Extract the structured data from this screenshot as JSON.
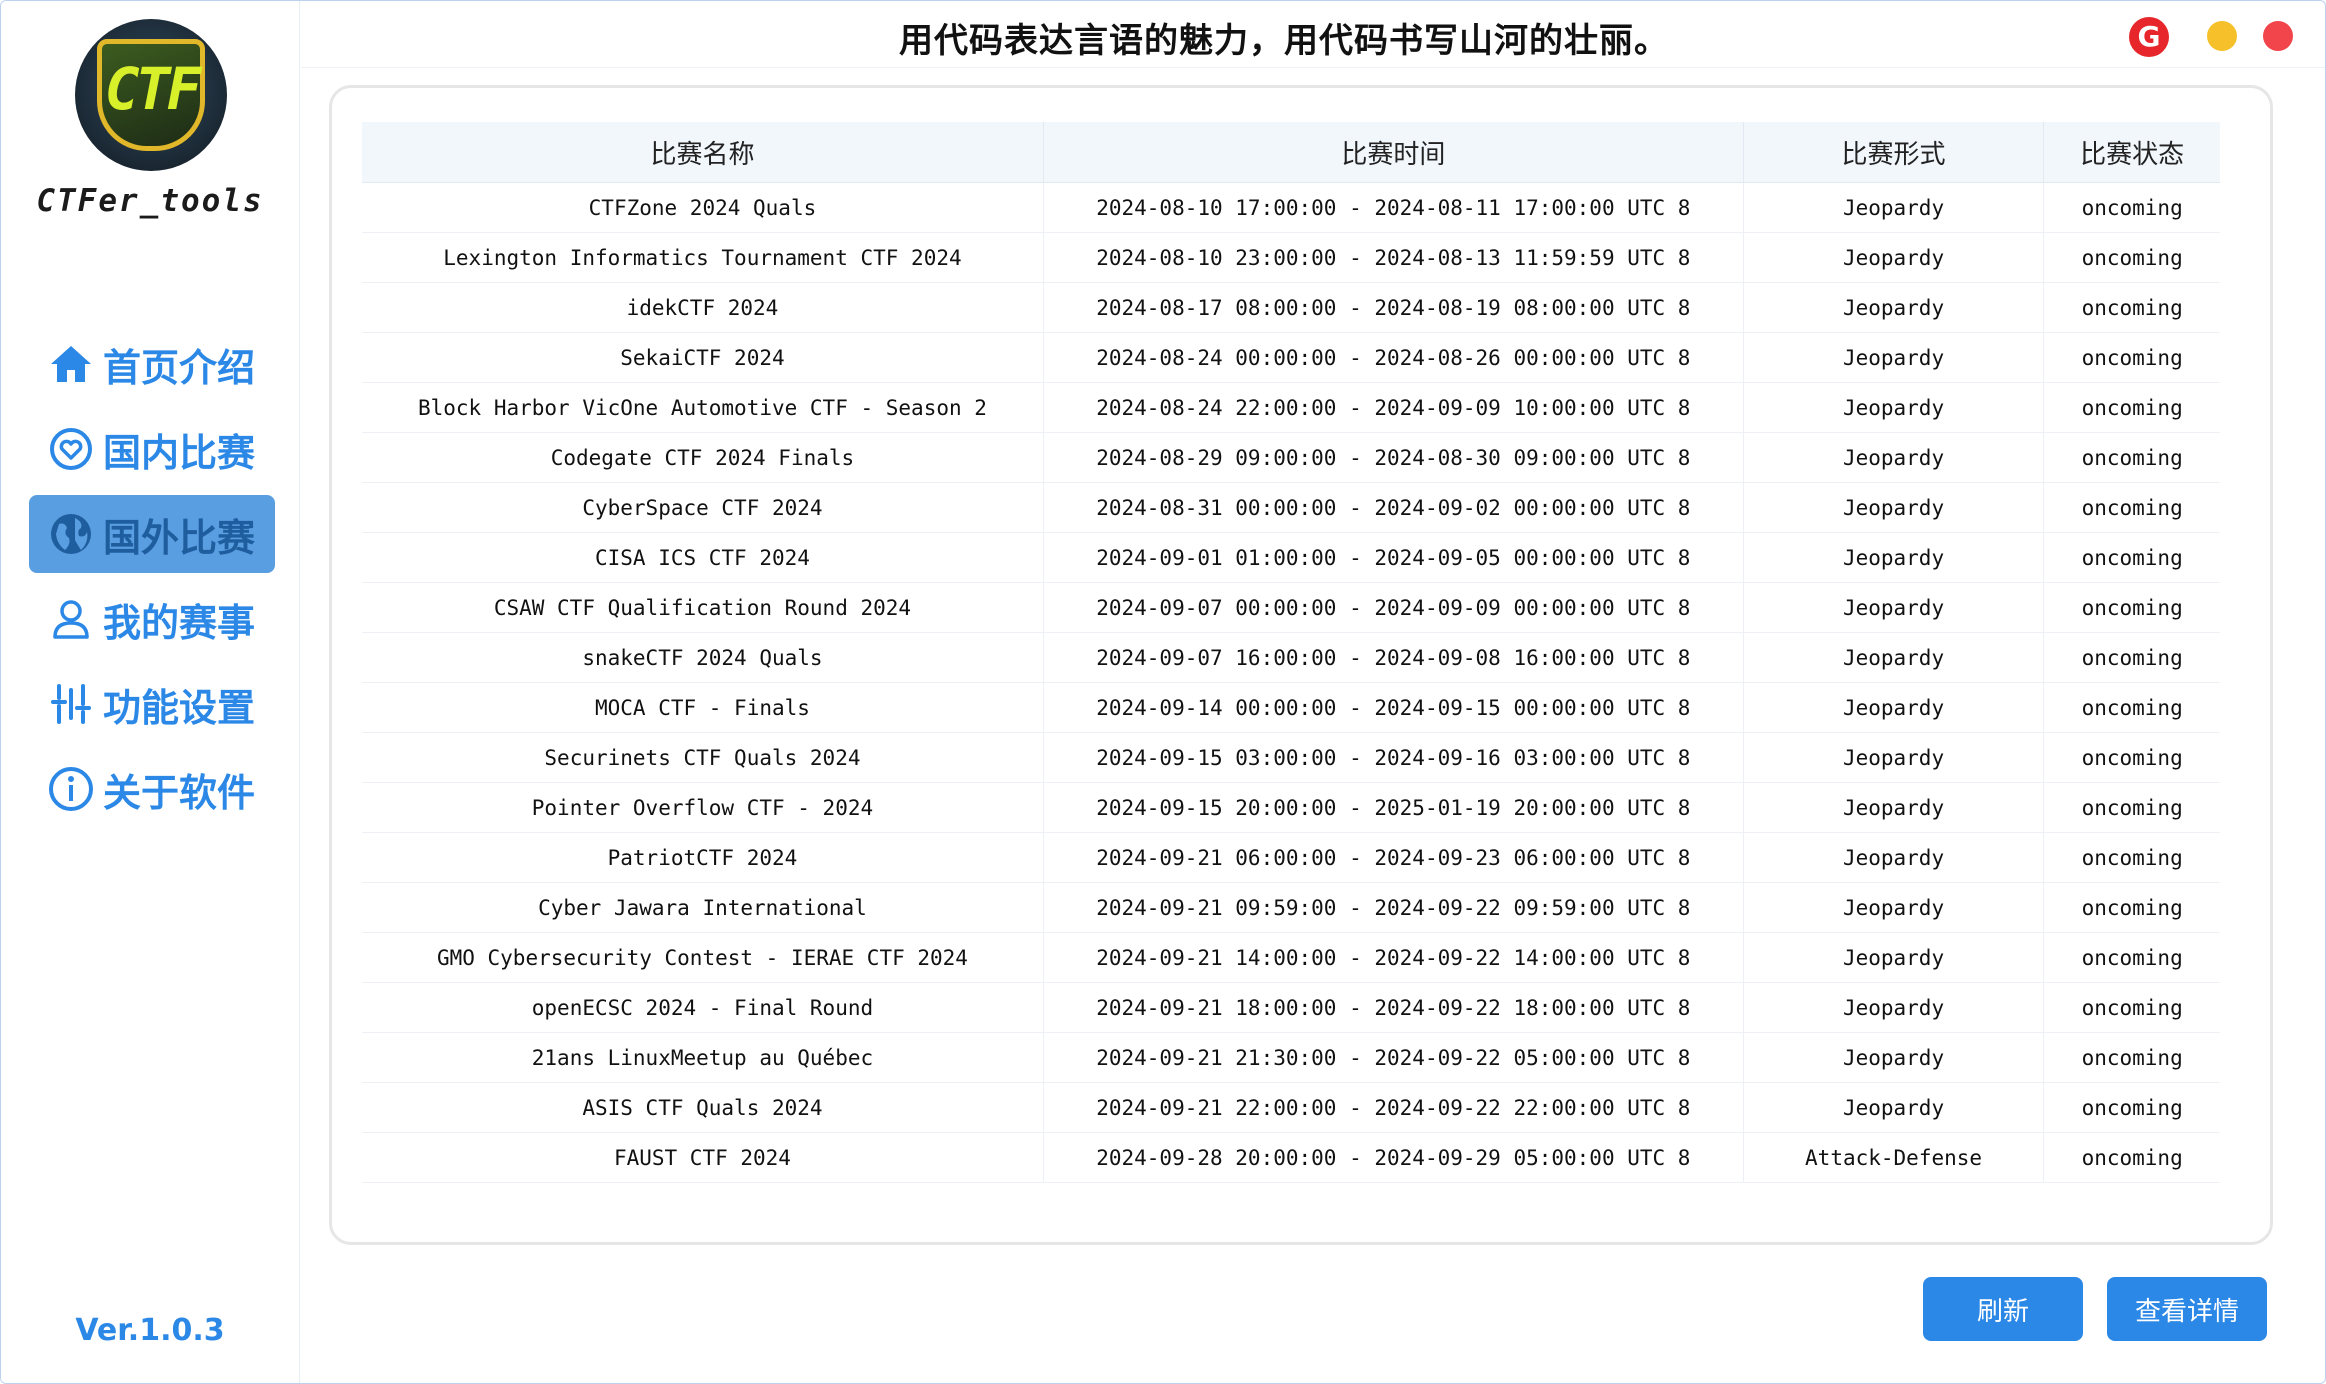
{
  "app": {
    "name": "CTFer_tools",
    "logo_text": "CTF",
    "version": "Ver.1.0.3",
    "slogan": "用代码表达言语的魅力，用代码书写山河的壮丽。"
  },
  "window_buttons": {
    "g_label": "G"
  },
  "sidebar": {
    "items": [
      {
        "label": "首页介绍",
        "icon": "home-icon"
      },
      {
        "label": "国内比赛",
        "icon": "heart-circle-icon"
      },
      {
        "label": "国外比赛",
        "icon": "globe-icon",
        "active": true
      },
      {
        "label": "我的赛事",
        "icon": "user-icon"
      },
      {
        "label": "功能设置",
        "icon": "sliders-icon"
      },
      {
        "label": "关于软件",
        "icon": "info-icon"
      }
    ]
  },
  "table": {
    "headers": [
      "比赛名称",
      "比赛时间",
      "比赛形式",
      "比赛状态"
    ],
    "rows": [
      [
        "CTFZone 2024 Quals",
        "2024-08-10 17:00:00 - 2024-08-11 17:00:00 UTC 8",
        "Jeopardy",
        "oncoming"
      ],
      [
        "Lexington Informatics Tournament CTF 2024",
        "2024-08-10 23:00:00 - 2024-08-13 11:59:59 UTC 8",
        "Jeopardy",
        "oncoming"
      ],
      [
        "idekCTF 2024",
        "2024-08-17 08:00:00 - 2024-08-19 08:00:00 UTC 8",
        "Jeopardy",
        "oncoming"
      ],
      [
        "SekaiCTF 2024",
        "2024-08-24 00:00:00 - 2024-08-26 00:00:00 UTC 8",
        "Jeopardy",
        "oncoming"
      ],
      [
        "Block Harbor VicOne Automotive CTF - Season 2",
        "2024-08-24 22:00:00 - 2024-09-09 10:00:00 UTC 8",
        "Jeopardy",
        "oncoming"
      ],
      [
        "Codegate CTF 2024 Finals",
        "2024-08-29 09:00:00 - 2024-08-30 09:00:00 UTC 8",
        "Jeopardy",
        "oncoming"
      ],
      [
        "CyberSpace CTF 2024",
        "2024-08-31 00:00:00 - 2024-09-02 00:00:00 UTC 8",
        "Jeopardy",
        "oncoming"
      ],
      [
        "CISA ICS CTF 2024",
        "2024-09-01 01:00:00 - 2024-09-05 00:00:00 UTC 8",
        "Jeopardy",
        "oncoming"
      ],
      [
        "CSAW CTF Qualification Round 2024",
        "2024-09-07 00:00:00 - 2024-09-09 00:00:00 UTC 8",
        "Jeopardy",
        "oncoming"
      ],
      [
        "snakeCTF 2024 Quals",
        "2024-09-07 16:00:00 - 2024-09-08 16:00:00 UTC 8",
        "Jeopardy",
        "oncoming"
      ],
      [
        "MOCA CTF - Finals",
        "2024-09-14 00:00:00 - 2024-09-15 00:00:00 UTC 8",
        "Jeopardy",
        "oncoming"
      ],
      [
        "Securinets CTF Quals 2024",
        "2024-09-15 03:00:00 - 2024-09-16 03:00:00 UTC 8",
        "Jeopardy",
        "oncoming"
      ],
      [
        "Pointer Overflow CTF - 2024",
        "2024-09-15 20:00:00 - 2025-01-19 20:00:00 UTC 8",
        "Jeopardy",
        "oncoming"
      ],
      [
        "PatriotCTF 2024",
        "2024-09-21 06:00:00 - 2024-09-23 06:00:00 UTC 8",
        "Jeopardy",
        "oncoming"
      ],
      [
        "Cyber Jawara International",
        "2024-09-21 09:59:00 - 2024-09-22 09:59:00 UTC 8",
        "Jeopardy",
        "oncoming"
      ],
      [
        "GMO Cybersecurity Contest - IERAE CTF 2024",
        "2024-09-21 14:00:00 - 2024-09-22 14:00:00 UTC 8",
        "Jeopardy",
        "oncoming"
      ],
      [
        "openECSC 2024 - Final Round",
        "2024-09-21 18:00:00 - 2024-09-22 18:00:00 UTC 8",
        "Jeopardy",
        "oncoming"
      ],
      [
        "21ans LinuxMeetup au Québec",
        "2024-09-21 21:30:00 - 2024-09-22 05:00:00 UTC 8",
        "Jeopardy",
        "oncoming"
      ],
      [
        "ASIS CTF Quals 2024",
        "2024-09-21 22:00:00 - 2024-09-22 22:00:00 UTC 8",
        "Jeopardy",
        "oncoming"
      ],
      [
        "FAUST CTF 2024",
        "2024-09-28 20:00:00 - 2024-09-29 05:00:00 UTC 8",
        "Attack-Defense",
        "oncoming"
      ]
    ]
  },
  "actions": {
    "refresh": "刷新",
    "details": "查看详情"
  },
  "colors": {
    "accent": "#2b88e6",
    "active_nav_bg": "#5a9ee2",
    "header_bg": "#f2f7fc"
  }
}
